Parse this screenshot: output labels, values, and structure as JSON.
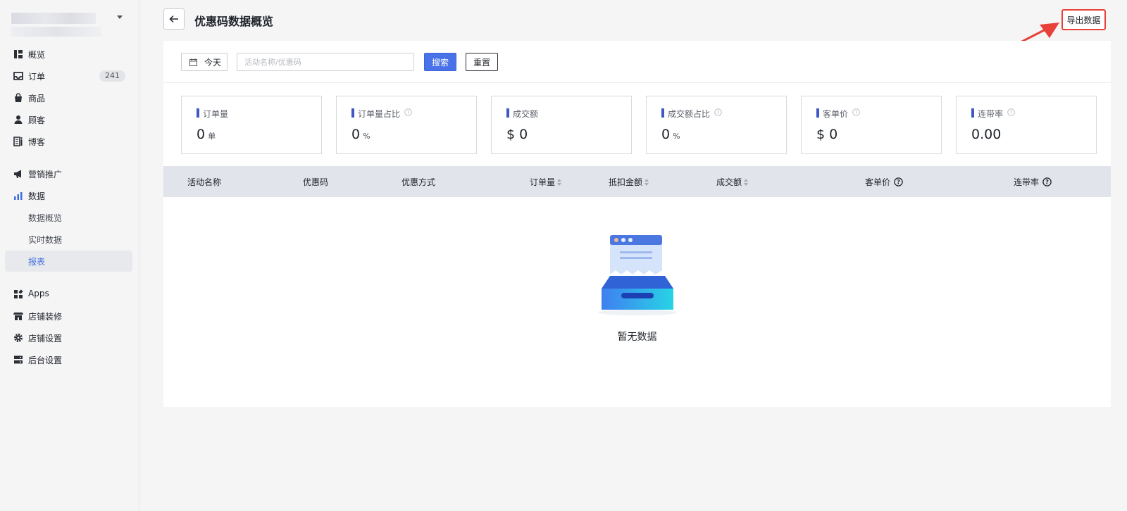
{
  "sidebar": {
    "items": [
      {
        "label": "概览",
        "icon": "overview-icon"
      },
      {
        "label": "订单",
        "icon": "inbox-icon",
        "badge": "241"
      },
      {
        "label": "商品",
        "icon": "bag-icon"
      },
      {
        "label": "顾客",
        "icon": "user-icon"
      },
      {
        "label": "博客",
        "icon": "blog-icon"
      },
      {
        "label": "营销推广",
        "icon": "megaphone-icon"
      },
      {
        "label": "数据",
        "icon": "bar-chart-icon"
      },
      {
        "label": "数据概览",
        "sub": true
      },
      {
        "label": "实时数据",
        "sub": true
      },
      {
        "label": "报表",
        "sub": true,
        "active": true
      },
      {
        "label": "Apps",
        "icon": "apps-icon"
      },
      {
        "label": "店铺装修",
        "icon": "store-icon"
      },
      {
        "label": "店铺设置",
        "icon": "gear-icon"
      },
      {
        "label": "后台设置",
        "icon": "server-icon"
      }
    ]
  },
  "header": {
    "title": "优惠码数据概览",
    "export_label": "导出数据"
  },
  "filters": {
    "date_label": "今天",
    "search_placeholder": "活动名称/优惠码",
    "search_label": "搜索",
    "reset_label": "重置"
  },
  "stats": [
    {
      "name": "订单量",
      "value": "0",
      "unit": "单",
      "help": false
    },
    {
      "name": "订单量占比",
      "value": "0",
      "unit": "%",
      "help": true
    },
    {
      "name": "成交额",
      "value": "$ 0",
      "unit": "",
      "help": false
    },
    {
      "name": "成交额占比",
      "value": "0",
      "unit": "%",
      "help": true
    },
    {
      "name": "客单价",
      "value": "$ 0",
      "unit": "",
      "help": true
    },
    {
      "name": "连带率",
      "value": "0.00",
      "unit": "",
      "help": true
    }
  ],
  "table": {
    "columns": [
      "活动名称",
      "优惠码",
      "优惠方式",
      "订单量",
      "抵扣金额",
      "成交额",
      "客单价",
      "连带率"
    ],
    "empty_text": "暂无数据"
  },
  "colors": {
    "accent": "#4a72e8",
    "active_nav_text": "#3f6de0",
    "stat_bar": "#4157c4",
    "highlight": "#e8413a"
  }
}
